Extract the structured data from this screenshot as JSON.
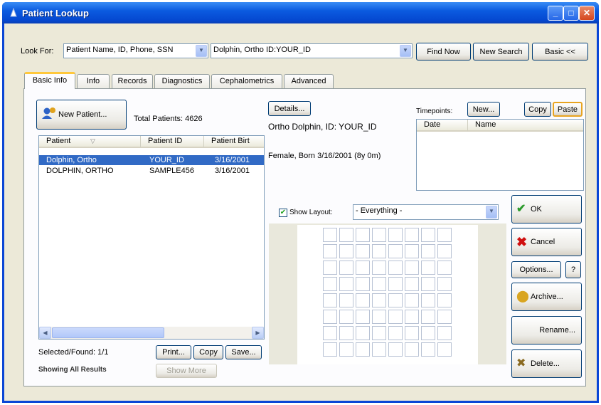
{
  "window": {
    "title": "Patient Lookup",
    "minimize_glyph": "_",
    "maximize_glyph": "□",
    "close_glyph": "✕"
  },
  "search": {
    "look_for_label": "Look For:",
    "field_selector_value": "Patient Name, ID, Phone, SSN",
    "query_value": "Dolphin, Ortho ID:YOUR_ID",
    "find_now_label": "Find Now",
    "new_search_label": "New Search",
    "basic_label": "Basic <<"
  },
  "tabs": [
    {
      "label": "Basic Info",
      "active": true
    },
    {
      "label": "Info",
      "active": false
    },
    {
      "label": "Records",
      "active": false
    },
    {
      "label": "Diagnostics",
      "active": false
    },
    {
      "label": "Cephalometrics",
      "active": false
    },
    {
      "label": "Advanced",
      "active": false
    }
  ],
  "patients": {
    "new_patient_label": "New Patient...",
    "total_patients_label": "Total Patients: 4626",
    "columns": [
      "Patient",
      "Patient ID",
      "Patient Birt"
    ],
    "sort_glyph": "▽",
    "rows": [
      {
        "name": "Dolphin, Ortho",
        "id": "YOUR_ID",
        "birth": "3/16/2001",
        "selected": true
      },
      {
        "name": "DOLPHIN, ORTHO",
        "id": "SAMPLE456",
        "birth": "3/16/2001",
        "selected": false
      }
    ],
    "selected_found": "Selected/Found: 1/1",
    "showing": "Showing All Results",
    "print_label": "Print...",
    "copy_label": "Copy",
    "save_label": "Save...",
    "show_more_label": "Show More"
  },
  "details": {
    "details_label": "Details...",
    "line1": "Ortho Dolphin, ID: YOUR_ID",
    "line2": "Female, Born 3/16/2001 (8y 0m)"
  },
  "timepoints": {
    "label": "Timepoints:",
    "new_label": "New...",
    "copy_label": "Copy",
    "paste_label": "Paste",
    "columns": [
      "Date",
      "Name"
    ]
  },
  "layout": {
    "show_layout_label": "Show Layout:",
    "show_layout_checked": true,
    "layout_value": "- Everything -",
    "grid_cols": 8,
    "grid_rows": 8
  },
  "actions": {
    "ok_label": "OK",
    "cancel_label": "Cancel",
    "options_label": "Options...",
    "help_label": "?",
    "archive_label": "Archive...",
    "rename_label": "Rename...",
    "delete_label": "Delete..."
  },
  "colors": {
    "title_bar": "#0548d0",
    "selection": "#316ac5",
    "ok_check": "#2a9a2a",
    "cancel_x": "#d01010"
  }
}
